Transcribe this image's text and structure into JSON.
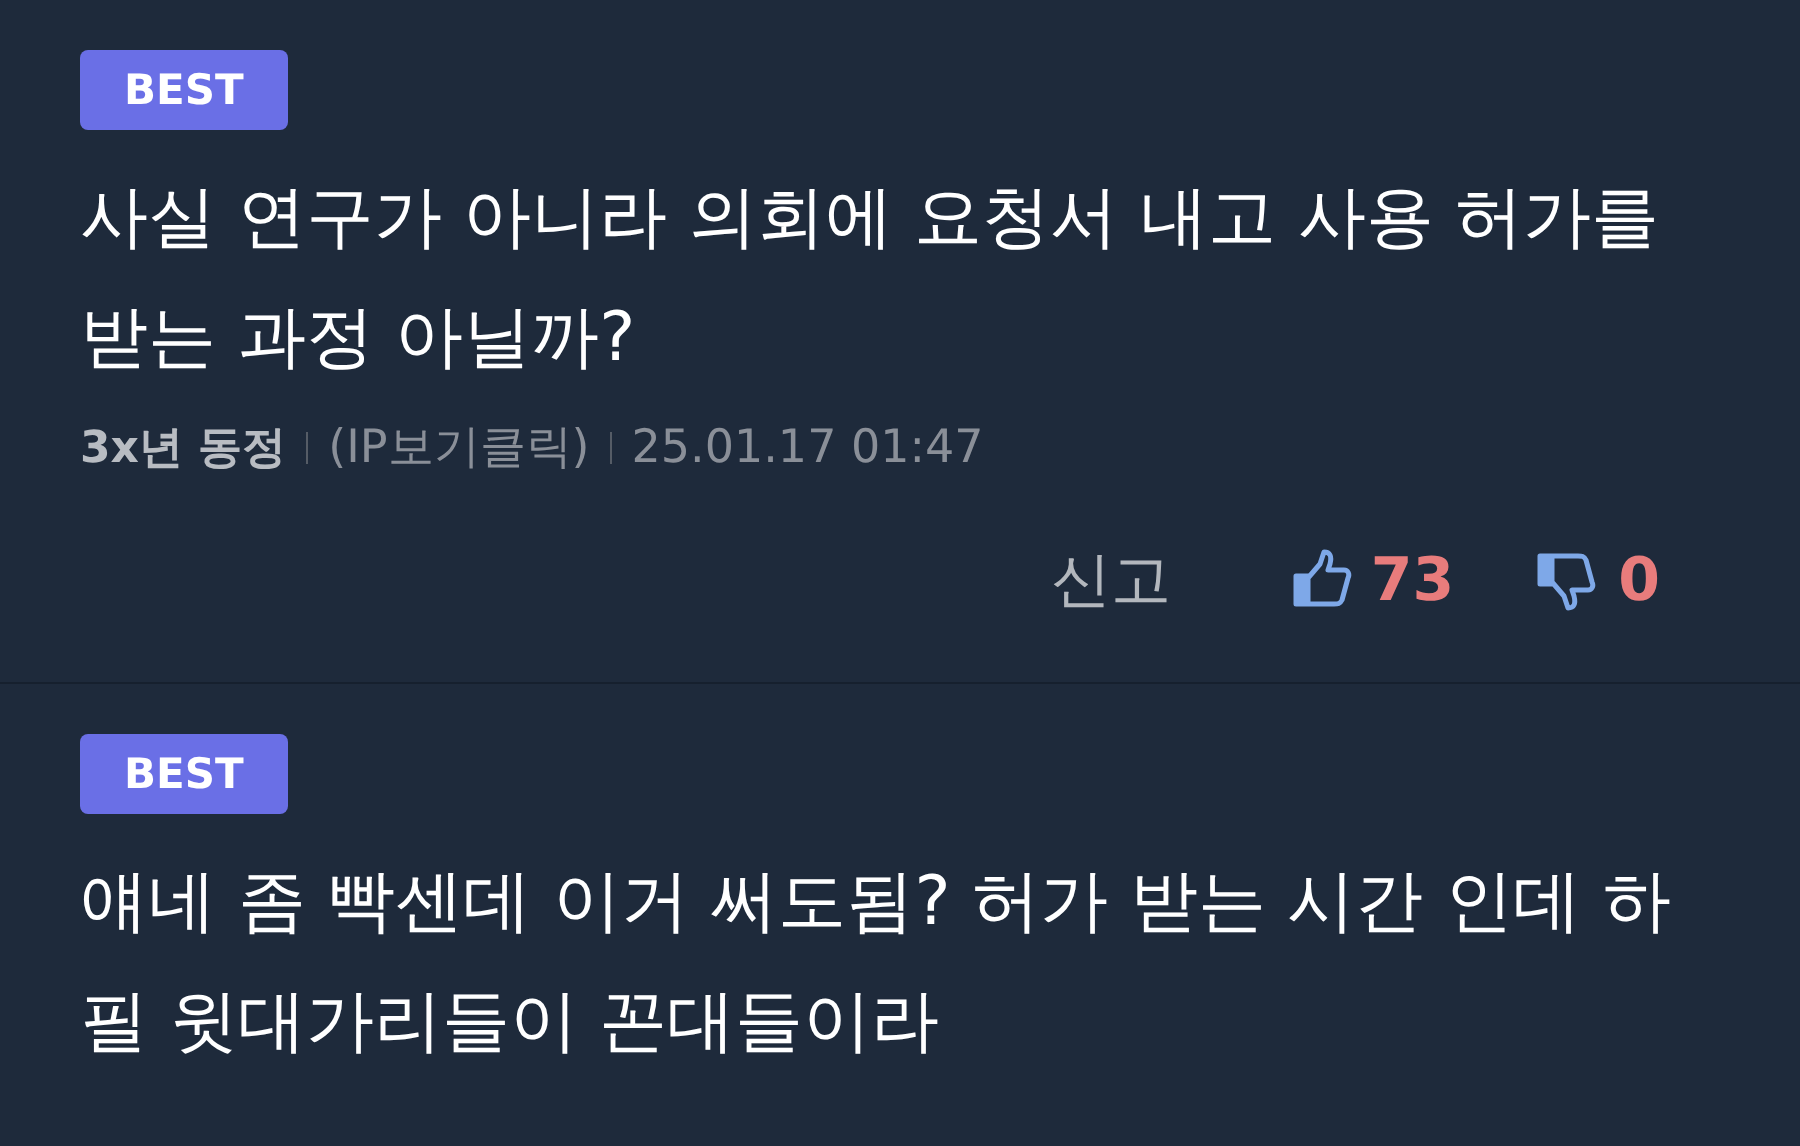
{
  "comments": [
    {
      "badge": "BEST",
      "text": "사실 연구가 아니라 의회에 요청서 내고 사용 허가를 받는 과정 아닐까?",
      "author": "3x년 동정",
      "ip": "(IP보기클릭)",
      "time": "25.01.17 01:47",
      "report": "신고",
      "likes": "73",
      "dislikes": "0"
    },
    {
      "badge": "BEST",
      "text": "얘네 좀 빡센데 이거 써도됨? 허가 받는 시간 인데 하필 윗대가리들이 꼰대들이라"
    }
  ]
}
